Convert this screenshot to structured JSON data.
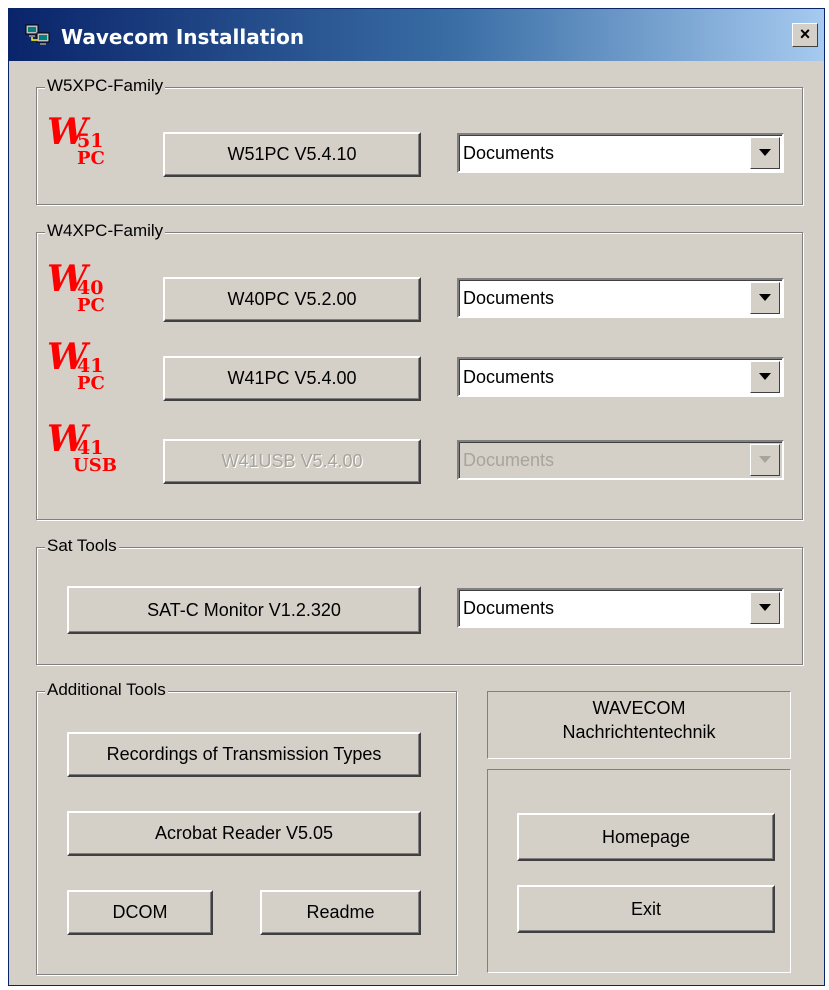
{
  "window": {
    "title": "Wavecom Installation",
    "close_label": "×"
  },
  "w5_family": {
    "label": "W5XPC-Family",
    "items": [
      {
        "logo_letter": "W",
        "logo_num": "51",
        "logo_sub": "PC",
        "button_label": "W51PC V5.4.10",
        "select_value": "Documents",
        "enabled": true
      }
    ]
  },
  "w4_family": {
    "label": "W4XPC-Family",
    "items": [
      {
        "logo_letter": "W",
        "logo_num": "40",
        "logo_sub": "PC",
        "button_label": "W40PC V5.2.00",
        "select_value": "Documents",
        "enabled": true
      },
      {
        "logo_letter": "W",
        "logo_num": "41",
        "logo_sub": "PC",
        "button_label": "W41PC V5.4.00",
        "select_value": "Documents",
        "enabled": true
      },
      {
        "logo_letter": "W",
        "logo_num": "41",
        "logo_sub": "USB",
        "button_label": "W41USB V5.4.00",
        "select_value": "Documents",
        "enabled": false
      }
    ]
  },
  "sat_tools": {
    "label": "Sat Tools",
    "button_label": "SAT-C Monitor V1.2.320",
    "select_value": "Documents"
  },
  "additional_tools": {
    "label": "Additional Tools",
    "recordings_label": "Recordings of Transmission Types",
    "acrobat_label": "Acrobat Reader V5.05",
    "dcom_label": "DCOM",
    "readme_label": "Readme"
  },
  "company": {
    "line1": "WAVECOM",
    "line2": "Nachrichtentechnik"
  },
  "actions": {
    "homepage_label": "Homepage",
    "exit_label": "Exit"
  },
  "colors": {
    "logo": "#ff0000",
    "face": "#d4d0c8",
    "title_start": "#0a246a",
    "title_end": "#a6caf0"
  }
}
